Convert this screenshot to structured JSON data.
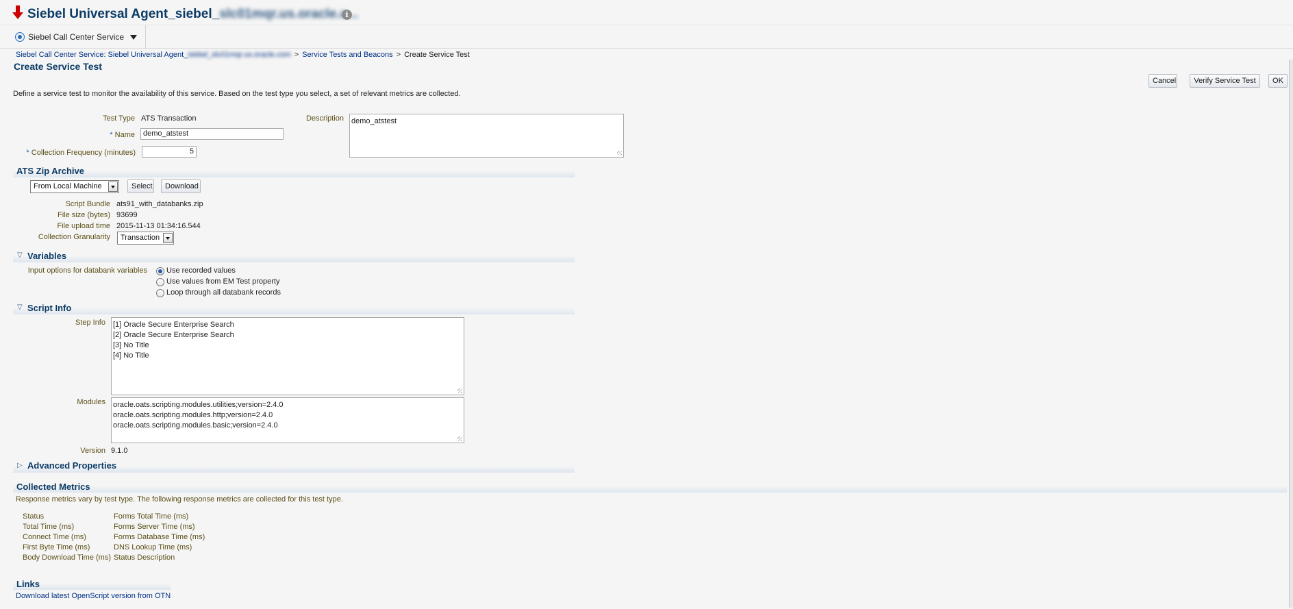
{
  "header": {
    "title": "Siebel Universal Agent_siebel_",
    "title_redacted": "slc01mqr.us.oracle.c...",
    "status_color": "#cc0000"
  },
  "target": {
    "label": "Siebel Call Center Service"
  },
  "breadcrumb": {
    "item1": "Siebel Call Center Service: Siebel Universal Agent_",
    "item1_redacted": "siebel_slc01mqr.us.oracle.com",
    "sep": ">",
    "item2": "Service Tests and Beacons",
    "current": "Create Service Test"
  },
  "page": {
    "title": "Create Service Test",
    "description": "Define a service test to monitor the availability of this service. Based on the test type you select, a set of relevant metrics are collected."
  },
  "buttons": {
    "cancel": "Cancel",
    "verify": "Verify Service Test",
    "ok": "OK"
  },
  "form": {
    "test_type_label": "Test Type",
    "test_type_value": "ATS Transaction",
    "name_label": "Name",
    "name_value": "demo_atstest",
    "required_mark": "*",
    "freq_label": "Collection Frequency (minutes)",
    "freq_value": "5",
    "desc_label": "Description",
    "desc_value": "demo_atstest"
  },
  "zip": {
    "title": "ATS Zip Archive",
    "source_select": "From Local Machine",
    "select_btn": "Select",
    "download_btn": "Download",
    "bundle_label": "Script Bundle",
    "bundle_value": "ats91_with_databanks.zip",
    "size_label": "File size (bytes)",
    "size_value": "93699",
    "upload_label": "File upload time",
    "upload_value": "2015-11-13 01:34:16.544",
    "granularity_label": "Collection Granularity",
    "granularity_value": "Transaction"
  },
  "variables": {
    "title": "Variables",
    "input_label": "Input options for databank variables",
    "options": [
      "Use recorded values",
      "Use values from EM Test property",
      "Loop through all databank records"
    ],
    "selected_index": 0
  },
  "script_info": {
    "title": "Script Info",
    "step_label": "Step Info",
    "steps": [
      "[1] Oracle Secure Enterprise Search",
      "[2] Oracle Secure Enterprise Search",
      "[3] No Title",
      "[4] No Title"
    ],
    "modules_label": "Modules",
    "modules": [
      "oracle.oats.scripting.modules.utilities;version=2.4.0",
      "oracle.oats.scripting.modules.http;version=2.4.0",
      "oracle.oats.scripting.modules.basic;version=2.4.0"
    ],
    "version_label": "Version",
    "version_value": "9.1.0"
  },
  "advanced": {
    "title": "Advanced Properties"
  },
  "collected": {
    "title": "Collected Metrics",
    "note": "Response metrics vary by test type. The following response metrics are collected for this test type.",
    "col1": [
      "Status",
      "Total Time (ms)",
      "Connect Time (ms)",
      "First Byte Time (ms)",
      "Body Download Time (ms)"
    ],
    "col2": [
      "Forms Total Time (ms)",
      "Forms Server Time (ms)",
      "Forms Database Time (ms)",
      "DNS Lookup Time (ms)",
      "Status Description"
    ]
  },
  "links": {
    "title": "Links",
    "download_link": "Download latest OpenScript version from OTN"
  }
}
